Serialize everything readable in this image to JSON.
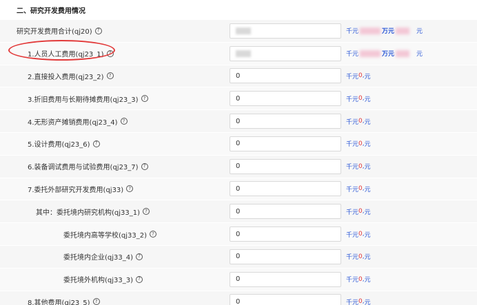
{
  "section": {
    "title": "二、研究开发费用情况"
  },
  "help_glyph": "?",
  "rows": [
    {
      "label": "研究开发费用合计(qj20)",
      "value": "",
      "unit": "千元",
      "amount": "万元",
      "yuan": "元",
      "masked": true
    },
    {
      "label": "1.人员人工费用(qj23_1)",
      "value": "",
      "unit": "千元",
      "amount": "万元",
      "yuan": "元",
      "masked": true
    },
    {
      "label": "2.直接投入费用(qj23_2)",
      "value": "0",
      "unit": "千元",
      "zero": "0",
      "yuan": "元"
    },
    {
      "label": "3.折旧费用与长期待摊费用(qj23_3)",
      "value": "0",
      "unit": "千元",
      "zero": "0",
      "yuan": "元"
    },
    {
      "label": "4.无形资产摊销费用(qj23_4)",
      "value": "0",
      "unit": "千元",
      "zero": "0",
      "yuan": "元"
    },
    {
      "label": "5.设计费用(qj23_6)",
      "value": "0",
      "unit": "千元",
      "zero": "0",
      "yuan": "元"
    },
    {
      "label": "6.装备调试费用与试验费用(qj23_7)",
      "value": "0",
      "unit": "千元",
      "zero": "0",
      "yuan": "元"
    },
    {
      "label": "7.委托外部研究开发费用(qj33)",
      "value": "0",
      "unit": "千元",
      "zero": "0",
      "yuan": "元"
    },
    {
      "label": "其中：委托境内研究机构(qj33_1)",
      "value": "0",
      "unit": "千元",
      "zero": "0",
      "yuan": "元"
    },
    {
      "label": "委托境内高等学校(qj33_2)",
      "value": "0",
      "unit": "千元",
      "zero": "0",
      "yuan": "元"
    },
    {
      "label": "委托境内企业(qj33_4)",
      "value": "0",
      "unit": "千元",
      "zero": "0",
      "yuan": "元"
    },
    {
      "label": "委托境外机构(qj33_3)",
      "value": "0",
      "unit": "千元",
      "zero": "0",
      "yuan": "元"
    },
    {
      "label": "8.其他费用(qj23_5)",
      "value": "0",
      "unit": "千元",
      "zero": "0",
      "yuan": "元"
    }
  ],
  "colors": {
    "accent_blue": "#2b57d6",
    "accent_red": "#e0383a",
    "annotation_red": "#e23a3a"
  }
}
